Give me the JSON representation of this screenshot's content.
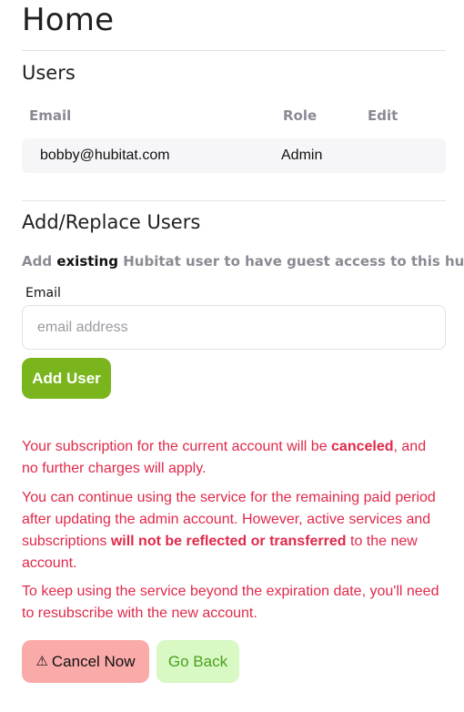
{
  "page": {
    "title": "Home"
  },
  "users_section": {
    "title": "Users",
    "columns": {
      "email": "Email",
      "role": "Role",
      "edit": "Edit"
    },
    "rows": [
      {
        "email": "bobby@hubitat.com",
        "role": "Admin"
      }
    ]
  },
  "add_section": {
    "title": "Add/Replace Users",
    "instruction_prefix": "Add",
    "instruction_strong": "existing",
    "instruction_suffix": "Hubitat user to have guest access to this hub:",
    "email_label": "Email",
    "email_placeholder": "email address",
    "email_value": "",
    "add_button": "Add User"
  },
  "warning": {
    "p1_a": "Your subscription for the current account will be ",
    "p1_strong": "canceled",
    "p1_b": ", and no further charges will apply.",
    "p2_a": "You can continue using the service for the remaining paid period after updating the admin account. However, active services and subscriptions ",
    "p2_strong": "will not be reflected or transferred",
    "p2_b": " to the new account.",
    "p3": "To keep using the service beyond the expiration date, you'll need to resubscribe with the new account."
  },
  "actions": {
    "cancel_icon": "⚠",
    "cancel_label": "Cancel Now",
    "back_label": "Go Back"
  },
  "colors": {
    "accent_green": "#7ab51d",
    "warning_red": "#e0294a",
    "cancel_bg": "#fbaaaa",
    "back_bg": "#d8f8c4"
  }
}
